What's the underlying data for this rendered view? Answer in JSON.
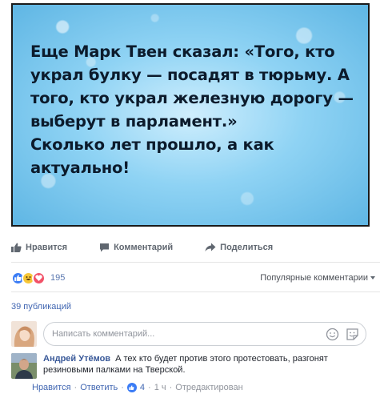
{
  "post": {
    "quote_text": "Еще Марк Твен сказал: «Того, кто\nукрал булку — посадят в тюрьму. А\nтого, кто украл железную дорогу —\nвыберут в парламент.»\nСколько лет прошло, а как\nактуально!"
  },
  "actions": {
    "like_label": "Нравится",
    "comment_label": "Комментарий",
    "share_label": "Поделиться"
  },
  "reactions": {
    "count": "195",
    "sort_label": "Популярные комментарии"
  },
  "shares": {
    "label": "39 публикаций"
  },
  "compose": {
    "placeholder": "Написать комментарий..."
  },
  "comment": {
    "author": "Андрей Утёмов",
    "text": "А тех кто будет против этого протестовать, разгонят резиновыми палками на Тверской.",
    "like_label": "Нравится",
    "reply_label": "Ответить",
    "like_count": "4",
    "time": "1 ч",
    "edited_label": "Отредактирован"
  },
  "colors": {
    "link_blue": "#4267b2",
    "like_blue": "#3b7cf5",
    "love_red": "#f25268",
    "haha_yellow": "#f7c737"
  }
}
